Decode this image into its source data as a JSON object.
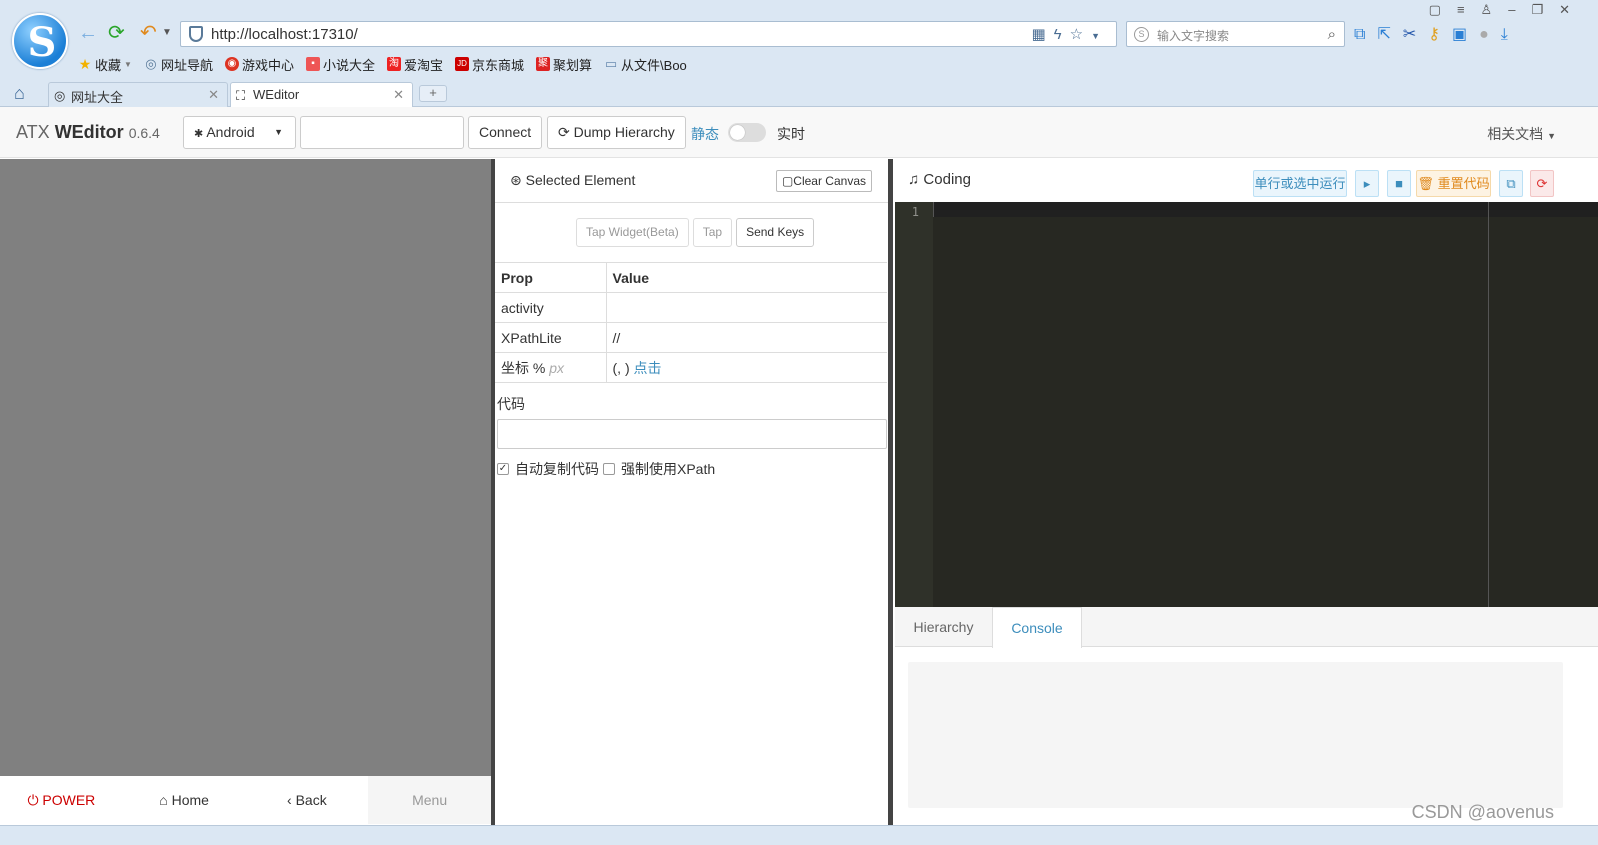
{
  "browser": {
    "logo_letter": "S",
    "url": "http://localhost:17310/",
    "search_placeholder": "输入文字搜索",
    "bookmarks": [
      {
        "label": "收藏",
        "icon": "star-icon",
        "glyph": "★",
        "color": "#f2b200"
      },
      {
        "label": "网址导航",
        "icon": "globe-icon",
        "glyph": "◎",
        "color": "#5a7a99"
      },
      {
        "label": "游戏中心",
        "icon": "game-icon",
        "glyph": "◉",
        "color": "#d32"
      },
      {
        "label": "小说大全",
        "icon": "book-icon",
        "glyph": "▪",
        "color": "#e55"
      },
      {
        "label": "爱淘宝",
        "icon": "taobao-icon",
        "glyph": "淘",
        "color": "#e22"
      },
      {
        "label": "京东商城",
        "icon": "jd-icon",
        "glyph": "JD",
        "color": "#c00"
      },
      {
        "label": "聚划算",
        "icon": "juhuasuan-icon",
        "glyph": "聚",
        "color": "#d22"
      },
      {
        "label": "从文件\\Boo",
        "icon": "folder-icon",
        "glyph": "▭",
        "color": "#6a8bb0"
      }
    ],
    "tabs": [
      {
        "label": "网址大全"
      },
      {
        "label": "WEditor"
      }
    ]
  },
  "app": {
    "brand_prefix": "ATX",
    "brand_name": "WEditor",
    "version": "0.6.4",
    "platform": "Android",
    "connect_label": "Connect",
    "dump_label": "Dump Hierarchy",
    "static_label": "静态",
    "live_label": "实时",
    "docs_label": "相关文档"
  },
  "device": {
    "power_label": "POWER",
    "home_label": "Home",
    "back_label": "Back",
    "menu_label": "Menu"
  },
  "inspector": {
    "title": "Selected Element",
    "clear_label": "Clear Canvas",
    "tap_widget_label": "Tap Widget(Beta)",
    "tap_label": "Tap",
    "send_keys_label": "Send Keys",
    "col_prop": "Prop",
    "col_value": "Value",
    "rows": [
      {
        "prop": "activity",
        "value": ""
      },
      {
        "prop": "XPathLite",
        "value": "//"
      }
    ],
    "coord_prop": "坐标 %",
    "coord_unit": "px",
    "coord_value": "(, )",
    "coord_link": "点击",
    "code_label": "代码",
    "auto_copy_label": "自动复制代码",
    "force_xpath_label": "强制使用XPath"
  },
  "coding": {
    "title": "Coding",
    "run_label": "单行或选中运行",
    "reset_label": "重置代码",
    "line_number": "1",
    "tab_hierarchy": "Hierarchy",
    "tab_console": "Console"
  },
  "watermark": "CSDN @aovenus"
}
